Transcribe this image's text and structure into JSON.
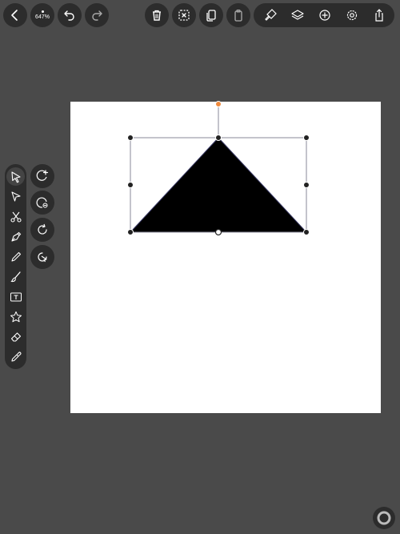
{
  "top_bar": {
    "zoom_label": "647%",
    "left_buttons": [
      "back-icon",
      "zoom-indicator",
      "undo-icon",
      "redo-icon"
    ],
    "middle_buttons": [
      "trash-icon",
      "deselect-icon",
      "duplicate-icon",
      "clipboard-icon"
    ],
    "right_pill_icons": [
      "style-brush-icon",
      "layers-icon",
      "add-icon",
      "settings-icon",
      "share-icon"
    ]
  },
  "left_toolbar": {
    "tools": [
      {
        "name": "selection-arrow-icon",
        "active": true
      },
      {
        "name": "direct-selection-icon",
        "active": false
      },
      {
        "name": "scissors-icon",
        "active": false
      },
      {
        "name": "pen-tool-icon",
        "active": false
      },
      {
        "name": "pencil-icon",
        "active": false
      },
      {
        "name": "brush-icon",
        "active": false
      },
      {
        "name": "text-tool-icon",
        "active": false
      },
      {
        "name": "star-shape-icon",
        "active": false
      },
      {
        "name": "eraser-icon",
        "active": false
      },
      {
        "name": "eyedropper-icon",
        "active": false
      }
    ],
    "side_buttons": [
      "add-node-icon",
      "remove-node-icon",
      "rotate-icon",
      "convert-node-icon"
    ]
  },
  "canvas": {
    "background": "#ffffff",
    "shape": {
      "type": "triangle",
      "fill": "#000000",
      "stroke": "#3a3a66"
    },
    "selection": {
      "box_color": "#8a8a9a",
      "rotation_handle_color": "#f08a3c",
      "handle_color": "#222222"
    }
  },
  "colors": {
    "app_background": "#4a4a4a",
    "button_background": "#2c2c2c",
    "icon_color": "#ffffff"
  }
}
